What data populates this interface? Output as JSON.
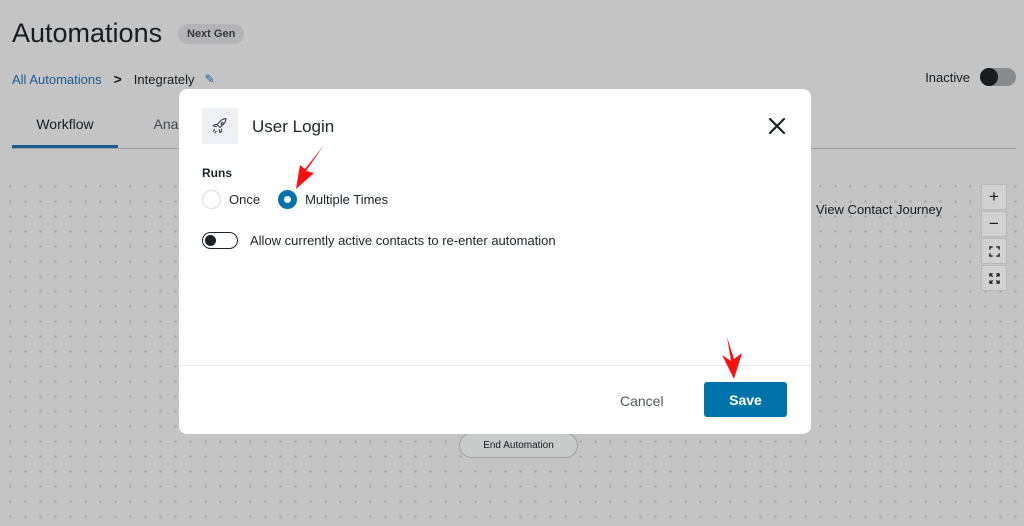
{
  "header": {
    "title": "Automations",
    "badge": "Next Gen"
  },
  "breadcrumb": {
    "root": "All Automations",
    "separator": ">",
    "current": "Integrately"
  },
  "status": {
    "label": "Inactive",
    "active": false
  },
  "tabs": [
    {
      "label": "Workflow",
      "active": true
    },
    {
      "label": "Analy",
      "active": false
    }
  ],
  "canvas": {
    "journey_link": "View Contact Journey",
    "end_node": "End Automation",
    "zoom_controls": [
      "zoom-in",
      "zoom-out",
      "fit-view",
      "fullscreen"
    ]
  },
  "modal": {
    "icon": "rocket-icon",
    "title": "User Login",
    "runs_label": "Runs",
    "run_options": [
      {
        "label": "Once",
        "checked": false
      },
      {
        "label": "Multiple Times",
        "checked": true
      }
    ],
    "reenter_toggle": {
      "label": "Allow currently active contacts to re-enter automation",
      "on": false
    },
    "cancel_label": "Cancel",
    "save_label": "Save"
  },
  "annotations": {
    "arrow_color": "#ff0000"
  },
  "colors": {
    "primary": "#0073aa",
    "link": "#2271b1"
  }
}
